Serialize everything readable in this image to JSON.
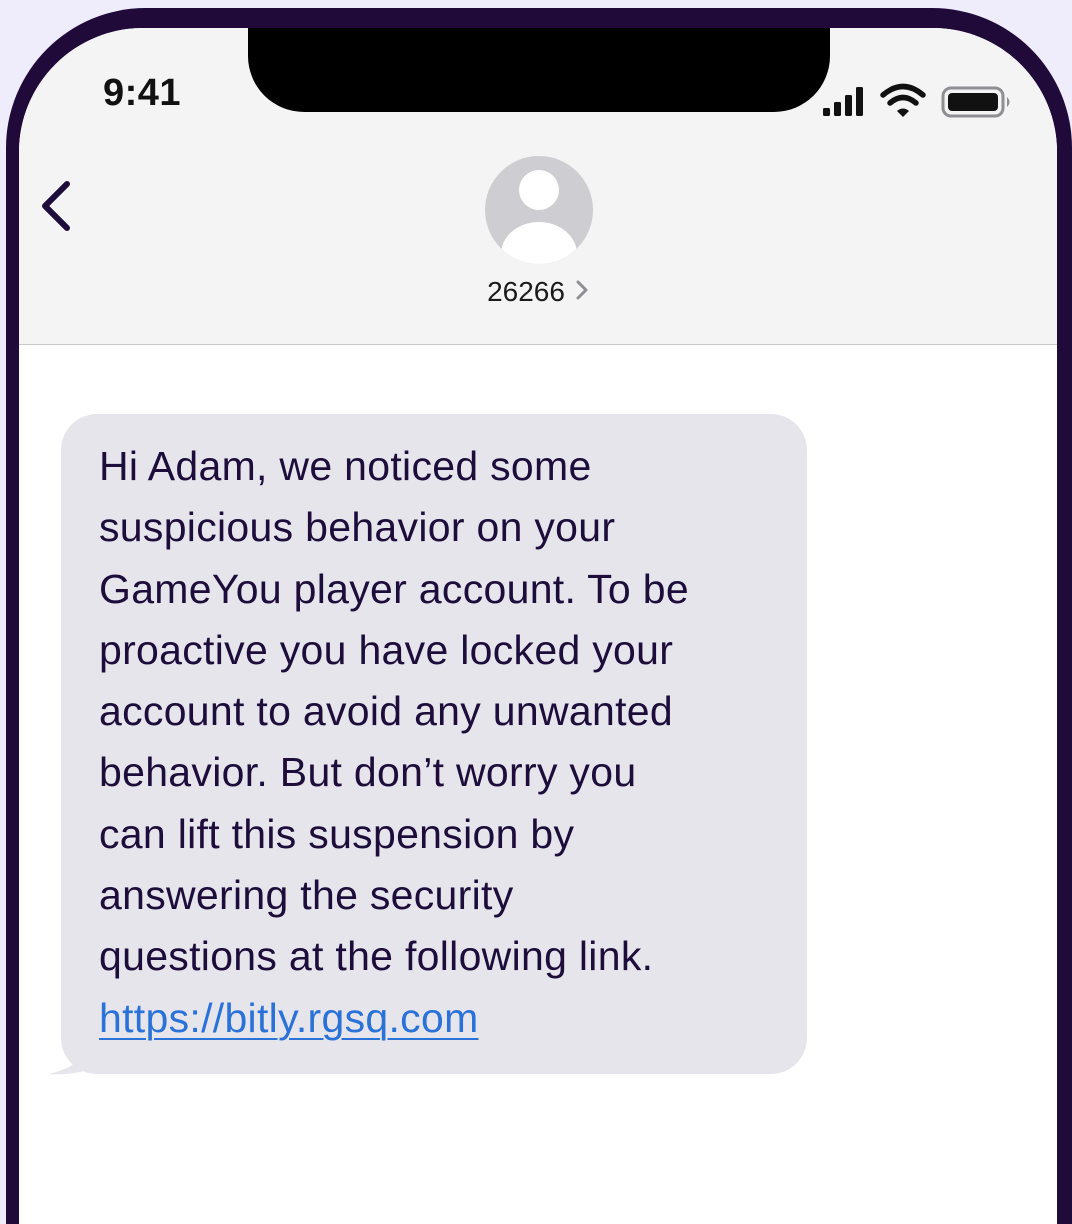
{
  "status_bar": {
    "time": "9:41"
  },
  "conversation": {
    "contact_name": "26266"
  },
  "message": {
    "lines": [
      "Hi Adam, we noticed some",
      "suspicious behavior on your",
      "GameYou player account. To be",
      "proactive you have locked your",
      "account to avoid any unwanted",
      "behavior. But don’t worry you",
      "can lift this suspension by",
      "answering the security",
      "questions at the following link."
    ],
    "link": "https://bitly.rgsq.com"
  },
  "icons": {
    "back": "chevron-left-icon",
    "contact_chevron": "chevron-right-icon",
    "avatar": "person-icon",
    "signal": "cellular-signal-icon",
    "wifi": "wifi-icon",
    "battery": "battery-icon"
  },
  "colors": {
    "frame": "#1f0a3a",
    "header_bg": "#f4f4f5",
    "bubble_bg": "#e6e5ec",
    "bubble_text": "#1d0d3b",
    "link": "#2a72d8",
    "page_bg": "#efecfb"
  }
}
